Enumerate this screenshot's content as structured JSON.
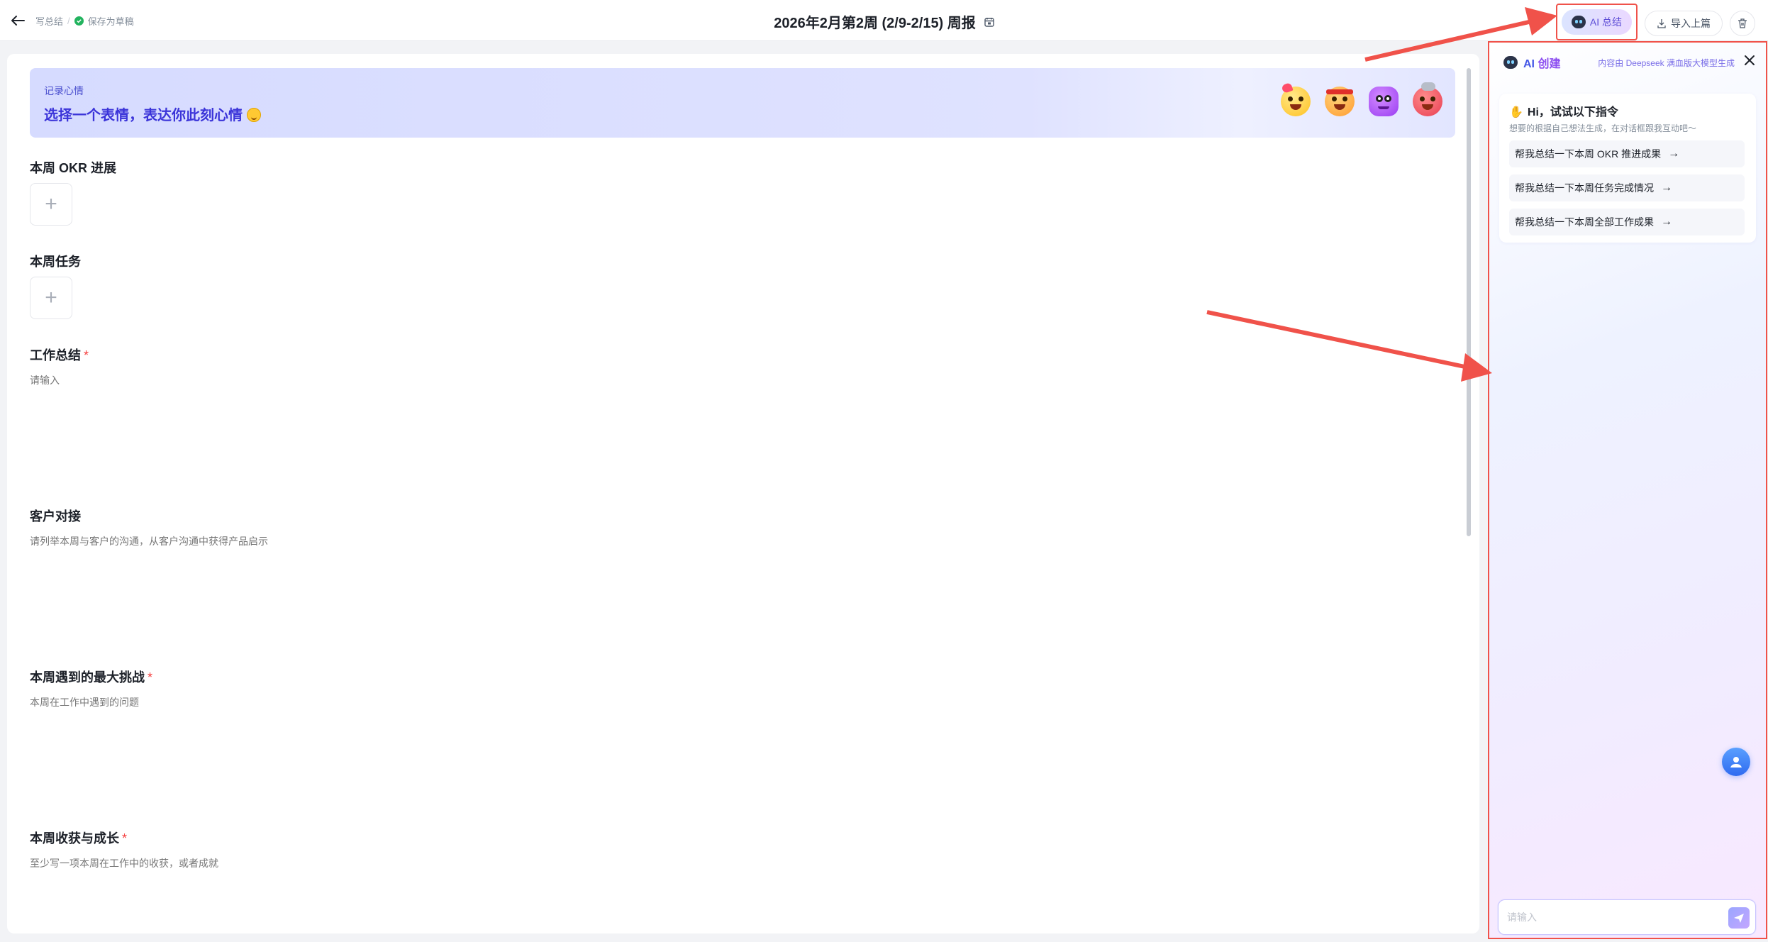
{
  "header": {
    "breadcrumb": "写总结",
    "save_status": "保存为草稿",
    "title": "2026年2月第2周 (2/9-2/15) 周报",
    "ai_summary_label": "AI 总结",
    "import_label": "导入上篇"
  },
  "mood": {
    "label": "记录心情",
    "title": "选择一个表情，表达你此刻心情",
    "faces": [
      "love-face-icon",
      "angry-face-icon",
      "purple-face-icon",
      "mad-face-icon"
    ]
  },
  "sections": {
    "okr": {
      "title": "本周 OKR 进展"
    },
    "tasks": {
      "title": "本周任务"
    },
    "summary": {
      "title": "工作总结",
      "required": "*",
      "placeholder": "请输入"
    },
    "customer": {
      "title": "客户对接",
      "placeholder": "请列举本周与客户的沟通，从客户沟通中获得产品启示"
    },
    "challenge": {
      "title": "本周遇到的最大挑战",
      "required": "*",
      "placeholder": "本周在工作中遇到的问题"
    },
    "growth": {
      "title": "本周收获与成长",
      "required": "*",
      "placeholder": "至少写一项本周在工作中的收获，或者成就"
    }
  },
  "ai_panel": {
    "title_prefix": "AI",
    "title_suffix": "创建",
    "source": "内容由 Deepseek 满血版大模型生成",
    "greeting": "Hi，试试以下指令",
    "subtitle": "想要的根据自己想法生成，在对话框跟我互动吧～",
    "prompts": [
      "帮我总结一下本周 OKR 推进成果",
      "帮我总结一下本周任务完成情况",
      "帮我总结一下本周全部工作成果"
    ],
    "input_placeholder": "请输入"
  },
  "colors": {
    "accent": "#3b34d9",
    "annotation": "#f0524a",
    "required": "#f53f3f",
    "saved": "#22b35e"
  }
}
